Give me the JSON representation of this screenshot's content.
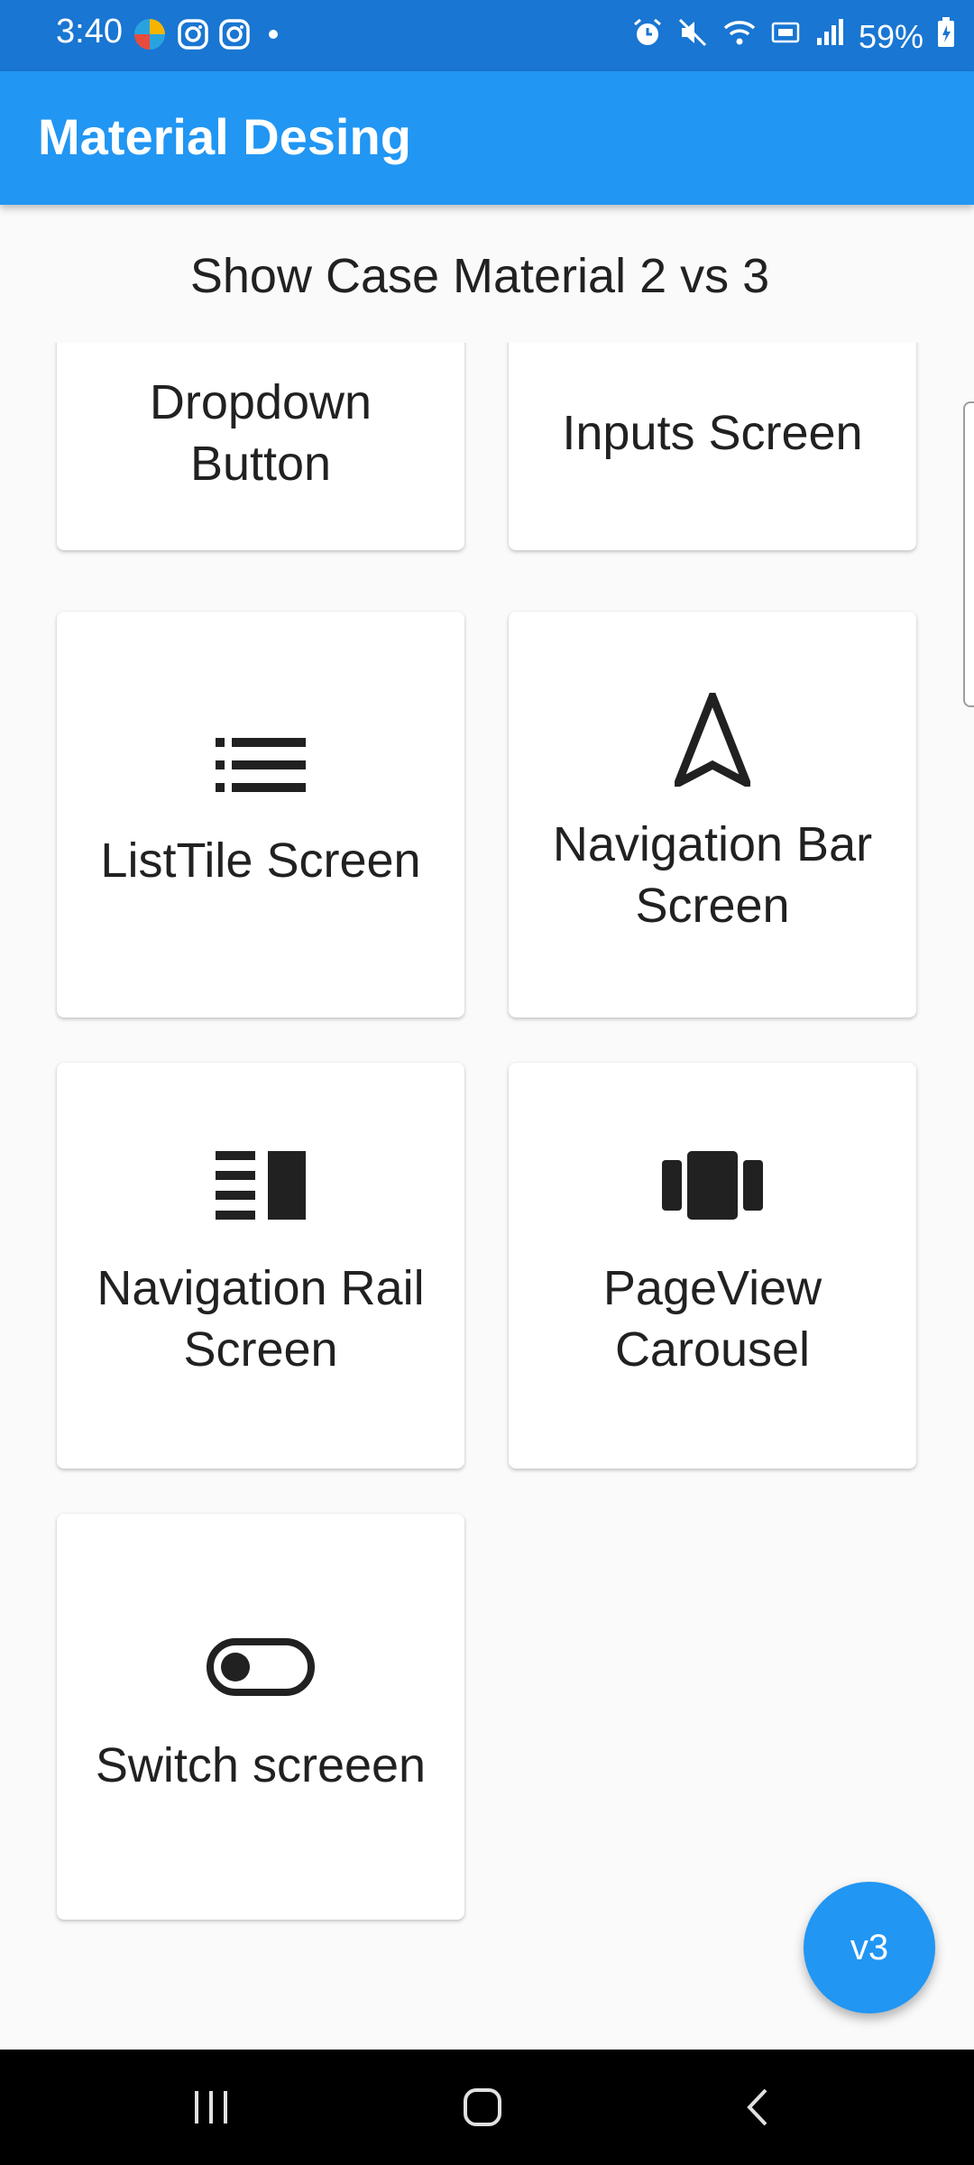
{
  "status_bar": {
    "time": "3:40",
    "battery": "59%",
    "icons": [
      "edge-browser-icon",
      "instagram-icon",
      "instagram-icon",
      "dot-icon",
      "alarm-icon",
      "mute-icon",
      "wifi-icon",
      "volte-icon",
      "signal-icon",
      "battery-icon"
    ]
  },
  "app_bar": {
    "title": "Material Desing"
  },
  "page": {
    "subtitle": "Show Case Material 2 vs 3"
  },
  "cards": [
    {
      "label": "Dropdown Button",
      "icon": ""
    },
    {
      "label": "Inputs Screen",
      "icon": ""
    },
    {
      "label": "ListTile Screen",
      "icon": "list-icon"
    },
    {
      "label": "Navigation Bar Screen",
      "icon": "navigation-arrow-icon"
    },
    {
      "label": "Navigation Rail Screen",
      "icon": "vertical-split-icon"
    },
    {
      "label": "PageView Carousel",
      "icon": "view-carousel-icon"
    },
    {
      "label": "Switch screeen",
      "icon": "toggle-off-icon"
    }
  ],
  "fab": {
    "label": "v3"
  },
  "colors": {
    "status_bar": "#1976d2",
    "app_bar": "#2196f3",
    "fab": "#2196f3",
    "background": "#fafafa"
  }
}
